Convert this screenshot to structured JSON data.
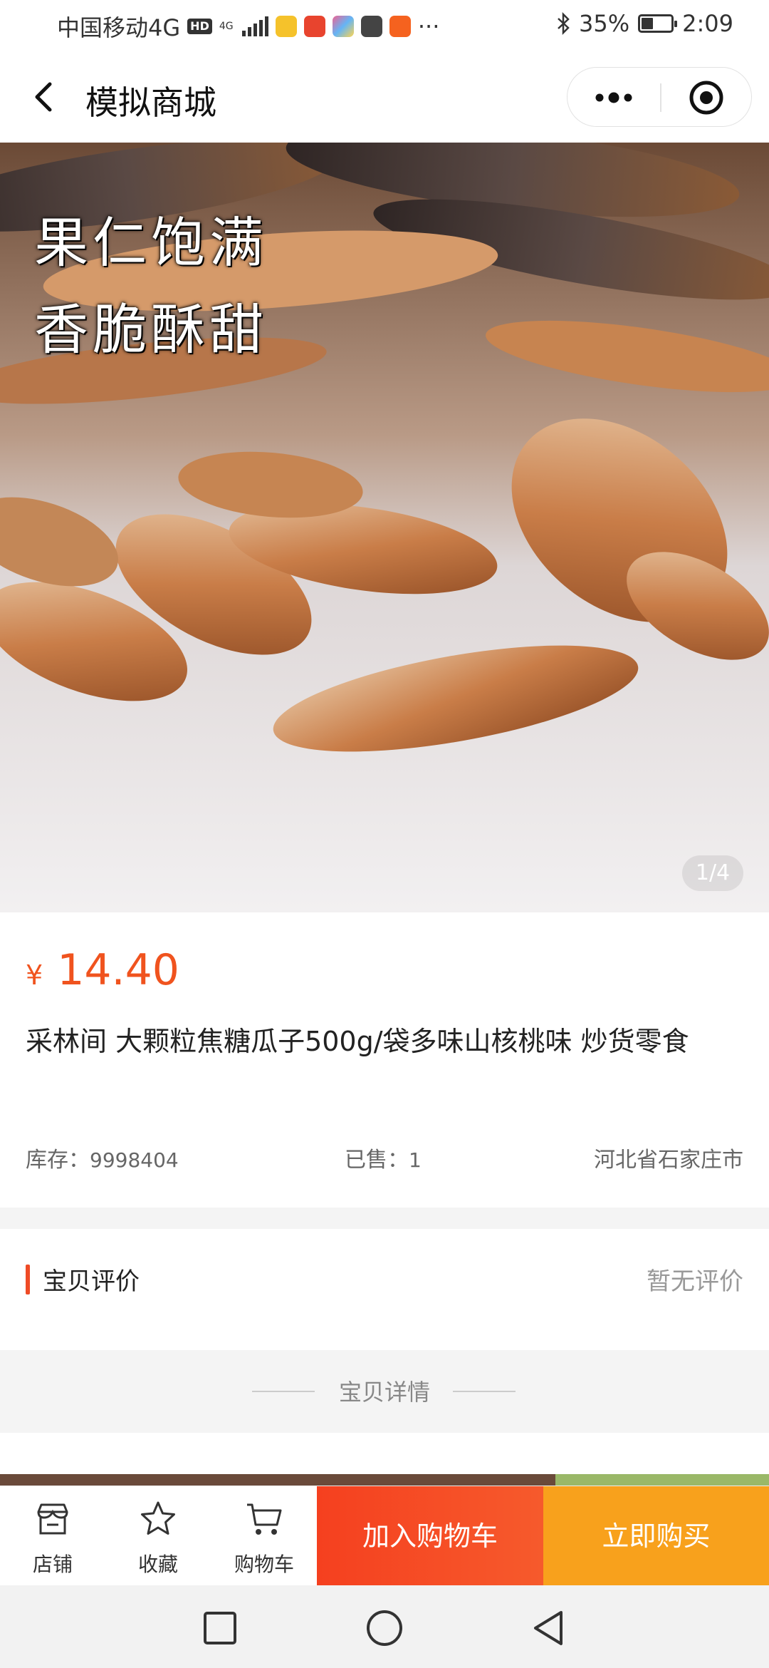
{
  "status_bar": {
    "carrier": "中国移动4G",
    "hd_badge": "HD",
    "network_type": "4G",
    "more_indicator": "···",
    "battery_percent": "35%",
    "battery_level": 0.35,
    "time": "2:09",
    "icons": [
      "hd-icon",
      "signal-icon",
      "notification-app-icons",
      "bluetooth-icon",
      "battery-icon"
    ]
  },
  "nav": {
    "title": "模拟商城",
    "back_icon": "chevron-left-icon",
    "more_icon": "more-dots-icon",
    "close_icon": "target-circle-icon"
  },
  "hero": {
    "overlay_line1": "果仁饱满",
    "overlay_line2": "香脆酥甜",
    "counter": "1/4"
  },
  "product": {
    "currency_symbol": "¥",
    "price": "14.40",
    "title": "采林间 大颗粒焦糖瓜子500g/袋多味山核桃味 炒货零食",
    "stock_label": "库存：",
    "stock_value": "9998404",
    "sold_label": "已售：",
    "sold_value": "1",
    "location": "河北省石家庄市"
  },
  "reviews": {
    "title": "宝贝评价",
    "empty_text": "暂无评价"
  },
  "details": {
    "title": "宝贝详情"
  },
  "action_bar": {
    "shop_label": "店铺",
    "favorite_label": "收藏",
    "cart_label": "购物车",
    "add_to_cart": "加入购物车",
    "buy_now": "立即购买"
  },
  "colors": {
    "price": "#f0531e",
    "accent_bar": "#ef4b26",
    "add_to_cart_bg": "#f5401f",
    "buy_now_bg": "#f8a11c"
  }
}
